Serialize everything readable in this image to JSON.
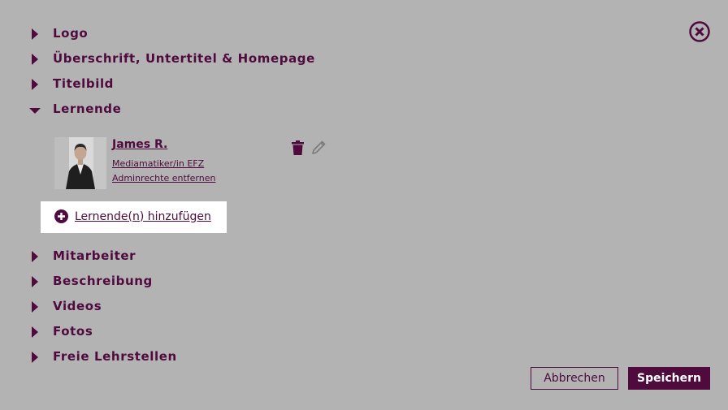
{
  "sections_top": [
    {
      "label": "Logo",
      "expanded": false
    },
    {
      "label": "Überschrift, Untertitel & Homepage",
      "expanded": false
    },
    {
      "label": "Titelbild",
      "expanded": false
    },
    {
      "label": "Lernende",
      "expanded": true
    }
  ],
  "learner": {
    "name": "James R.",
    "profession": "Mediamatiker/in EFZ",
    "admin_link": "Adminrechte entfernen",
    "delete_icon": "trash-icon",
    "edit_icon": "pencil-icon"
  },
  "add_learner": {
    "icon": "plus-circle-icon",
    "label": "Lernende(n) hinzufügen"
  },
  "sections_bottom": [
    {
      "label": "Mitarbeiter",
      "expanded": false
    },
    {
      "label": "Beschreibung",
      "expanded": false
    },
    {
      "label": "Videos",
      "expanded": false
    },
    {
      "label": "Fotos",
      "expanded": false
    },
    {
      "label": "Freie Lehrstellen",
      "expanded": false
    }
  ],
  "buttons": {
    "cancel": "Abbrechen",
    "save": "Speichern"
  },
  "colors": {
    "accent": "#4f0a3e",
    "background": "#b3b3b3",
    "highlight": "#ffffff"
  }
}
